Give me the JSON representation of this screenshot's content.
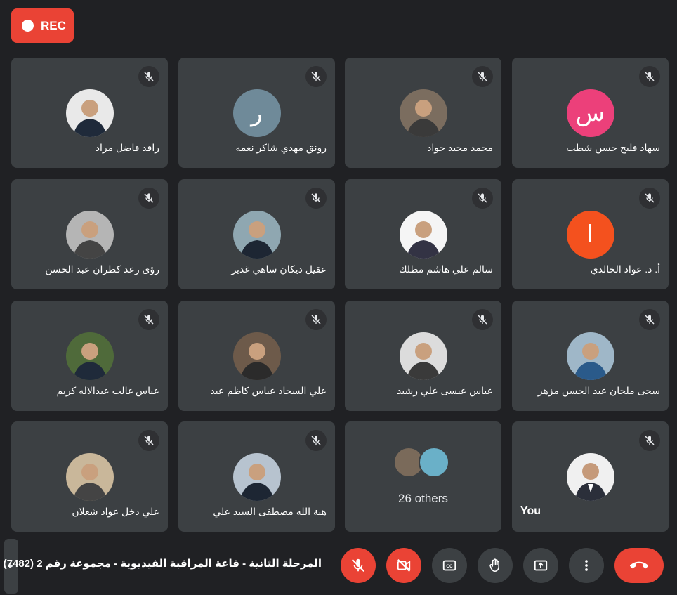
{
  "recording": {
    "label": "REC"
  },
  "participants": [
    {
      "name": "رافد فاضل مراد",
      "avatar_type": "photo",
      "avatar_color": "#e9e9e9"
    },
    {
      "name": "رونق مهدي شاكر نعمه",
      "avatar_type": "letter",
      "letter": "ر",
      "avatar_color": "#6f8a99"
    },
    {
      "name": "محمد مجيد جواد",
      "avatar_type": "photo",
      "avatar_color": "#7b6d5f"
    },
    {
      "name": "سهاد فليح حسن شطب",
      "avatar_type": "letter",
      "letter": "س",
      "avatar_color": "#ec407a"
    },
    {
      "name": "رؤى رعد كطران عبد الحسن",
      "avatar_type": "photo",
      "avatar_color": "#b5b5b5"
    },
    {
      "name": "عقيل ديكان ساهي غدير",
      "avatar_type": "photo",
      "avatar_color": "#8fa7b1"
    },
    {
      "name": "سالم علي هاشم مطلك",
      "avatar_type": "photo",
      "avatar_color": "#f5f5f5"
    },
    {
      "name": "أ. د. عواد الخالدي",
      "avatar_type": "letter",
      "letter": "ا",
      "avatar_color": "#f4511e"
    },
    {
      "name": "عباس غالب عبدالاله كريم",
      "avatar_type": "photo",
      "avatar_color": "#4f6a3a"
    },
    {
      "name": "علي السجاد عباس كاظم عبد",
      "avatar_type": "photo",
      "avatar_color": "#6d5a4a"
    },
    {
      "name": "عباس عيسى علي رشيد",
      "avatar_type": "photo",
      "avatar_color": "#dcdcdc"
    },
    {
      "name": "سجى ملحان عبد الحسن مزهر",
      "avatar_type": "photo",
      "avatar_color": "#9fb7c8"
    },
    {
      "name": "علي دخل عواد شعلان",
      "avatar_type": "photo",
      "avatar_color": "#c9b79a"
    },
    {
      "name": "هبة الله مصطفى السيد علي",
      "avatar_type": "photo",
      "avatar_color": "#b7c3cf"
    }
  ],
  "others": {
    "label": "26 others"
  },
  "self": {
    "name": "You",
    "avatar_type": "photo",
    "avatar_color": "#f0f0f0"
  },
  "meeting": {
    "title": "المرحلة الثانية - قاعة المراقبة الفيديوية - مجموعة رقم 2 (7482)"
  },
  "controls": {
    "mic": {
      "icon": "mic-off-icon",
      "state": "off"
    },
    "camera": {
      "icon": "videocam-off-icon",
      "state": "off"
    },
    "captions": {
      "icon": "closed-captions-icon"
    },
    "hand": {
      "icon": "raise-hand-icon"
    },
    "present": {
      "icon": "present-screen-icon"
    },
    "more": {
      "icon": "more-vert-icon"
    },
    "leave": {
      "icon": "call-end-icon"
    }
  },
  "colors": {
    "background": "#202124",
    "tile": "#3c4043",
    "danger": "#ea4335"
  }
}
